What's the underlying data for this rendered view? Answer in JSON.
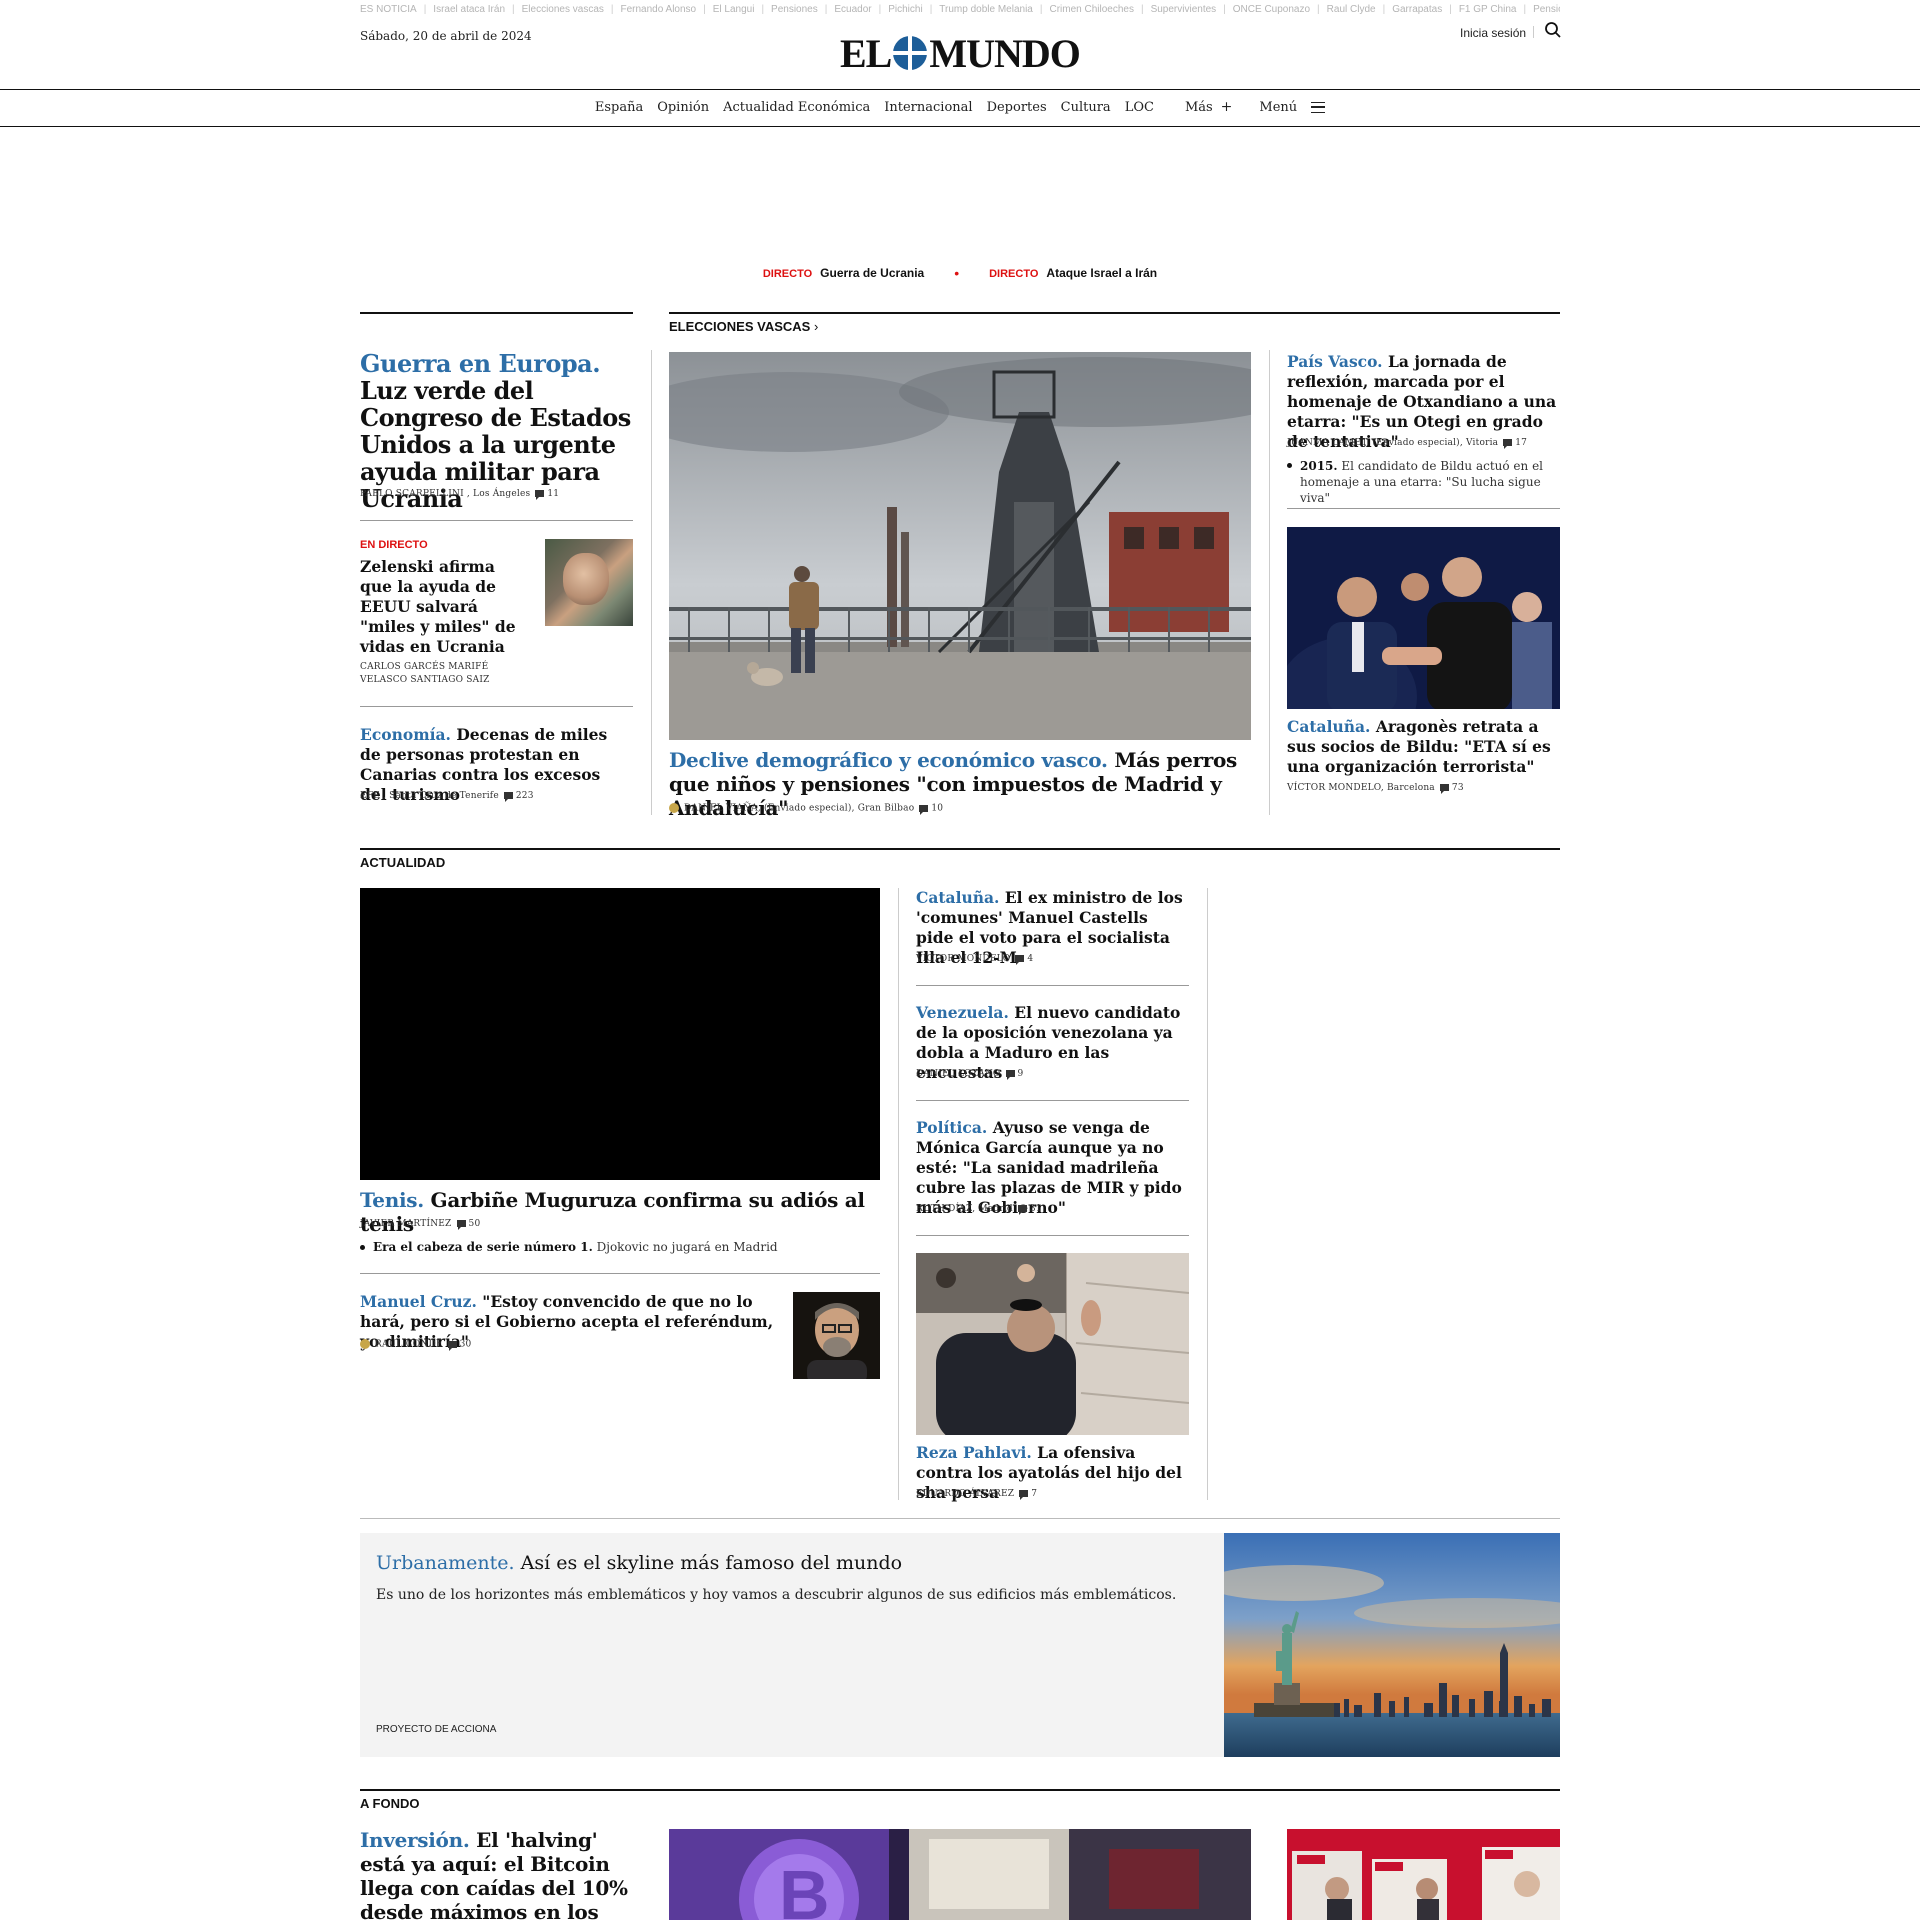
{
  "trending": [
    "ES NOTICIA",
    "Israel ataca Irán",
    "Elecciones vascas",
    "Fernando Alonso",
    "El Langui",
    "Pensiones",
    "Ecuador",
    "Pichichi",
    "Trump doble Melania",
    "Crimen Chiloeches",
    "Supervivientes",
    "ONCE Cuponazo",
    "Raul Clyde",
    "Garrapatas",
    "F1 GP China",
    "Pensiones"
  ],
  "header": {
    "date": "Sábado, 20 de abril de 2024",
    "logo_left": "EL",
    "logo_right": "MUNDO",
    "login": "Inicia sesión"
  },
  "nav": {
    "items": [
      "España",
      "Opinión",
      "Actualidad Económica",
      "Internacional",
      "Deportes",
      "Cultura",
      "LOC"
    ],
    "more": "Más",
    "menu": "Menú"
  },
  "live": [
    {
      "tag": "DIRECTO",
      "text": "Guerra de Ucrania"
    },
    {
      "tag": "DIRECTO",
      "text": "Ataque Israel a Irán"
    }
  ],
  "colors": {
    "accent": "#2d6ea7",
    "live": "#dd1111",
    "logo_globe": "#1d5e99"
  },
  "left_col": {
    "lead": {
      "kicker": "Guerra en Europa.",
      "title": "Luz verde del Congreso de Estados Unidos a la urgente ayuda militar para Ucrania",
      "author": "PABLO SCARPELLINI",
      "location": "Los Ángeles",
      "comments": "11"
    },
    "live_story": {
      "tag": "EN DIRECTO",
      "title": "Zelenski afirma que la ayuda de EEUU salvará \"miles y miles\" de vidas en Ucrania",
      "authors": "CARLOS GARCÉS   MARIFÉ VELASCO   SANTIAGO SAIZ"
    },
    "story3": {
      "kicker": "Economía.",
      "title": "Decenas de miles de personas protestan en Canarias contra los excesos del turismo",
      "author": "EFE",
      "location": "Santa Cruz de Tenerife",
      "comments": "223"
    }
  },
  "center_col": {
    "section": "ELECCIONES VASCAS",
    "lead": {
      "kicker": "Declive demográfico y económico vasco.",
      "title": "Más perros que niños y pensiones \"con impuestos de Madrid y Andalucía\"",
      "author": "DANIEL VIAÑA",
      "location": "(Enviado especial), Gran Bilbao",
      "comments": "10"
    }
  },
  "right_col": {
    "story1": {
      "kicker": "País Vasco.",
      "title": "La jornada de reflexión, marcada por el homenaje de Otxandiano a una etarra: \"Es un Otegi en grado de tentativa\"",
      "author": "JUANMA LAMET",
      "location": "(Enviado especial), Vitoria",
      "comments": "17",
      "bullet_bold": "2015.",
      "bullet_text": "El candidato de Bildu actuó en el homenaje a una etarra: \"Su lucha sigue viva\""
    },
    "story2": {
      "kicker": "Cataluña.",
      "title": "Aragonès retrata a sus socios de Bildu: \"ETA sí es una organización terrorista\"",
      "author": "VÍCTOR MONDELO",
      "location": "Barcelona",
      "comments": "73"
    }
  },
  "actualidad": {
    "section": "ACTUALIDAD",
    "lead": {
      "kicker": "Tenis.",
      "title": "Garbiñe Muguruza confirma su adiós al tenis",
      "author": "JAVIER MARTÍNEZ",
      "comments": "50",
      "bullet_bold": "Era el cabeza de serie número 1.",
      "bullet_text": "Djokovic no jugará en Madrid"
    },
    "interview": {
      "kicker": "Manuel Cruz.",
      "title": "\"Estoy convencido de que no lo hará, pero si el Gobierno acepta el referéndum, yo dimitiría\"",
      "author": "RAÚL CONDE",
      "comments": "30"
    },
    "side": [
      {
        "kicker": "Cataluña.",
        "title": "El ex ministro de los 'comunes' Manuel Castells pide el voto para el socialista Illa el 12-M",
        "author": "VÍCTOR MONDELO",
        "location": "",
        "comments": "4"
      },
      {
        "kicker": "Venezuela.",
        "title": "El nuevo candidato de la oposición venezolana ya dobla a Maduro en las encuestas",
        "author": "DANIEL LOZANO",
        "location": "",
        "comments": "9"
      },
      {
        "kicker": "Política.",
        "title": "Ayuso se venga de Mónica García aunque ya no esté: \"La sanidad madrileña cubre las plazas de MIR y pido más al Gobierno\"",
        "author": "RUTH DÍAZ",
        "location": "Madrid",
        "comments": "31"
      },
      {
        "kicker": "Reza Pahlavi.",
        "title": "La ofensiva contra los ayatolás del hijo del sha persa",
        "author": "EDUARDO ÁLVAREZ",
        "location": "",
        "comments": "7"
      }
    ]
  },
  "urbanamente": {
    "kicker": "Urbanamente.",
    "title": "Así es el skyline más famoso del mundo",
    "text": "Es uno de los horizontes más emblemáticos y hoy vamos a descubrir algunos de sus edificios más emblemáticos.",
    "sponsor": "PROYECTO DE ACCIONA"
  },
  "a_fondo": {
    "section": "A FONDO",
    "lead": {
      "kicker": "Inversión.",
      "title": "El 'halving' está ya aquí: el Bitcoin llega con caídas del 10% desde máximos en los últimos"
    }
  }
}
